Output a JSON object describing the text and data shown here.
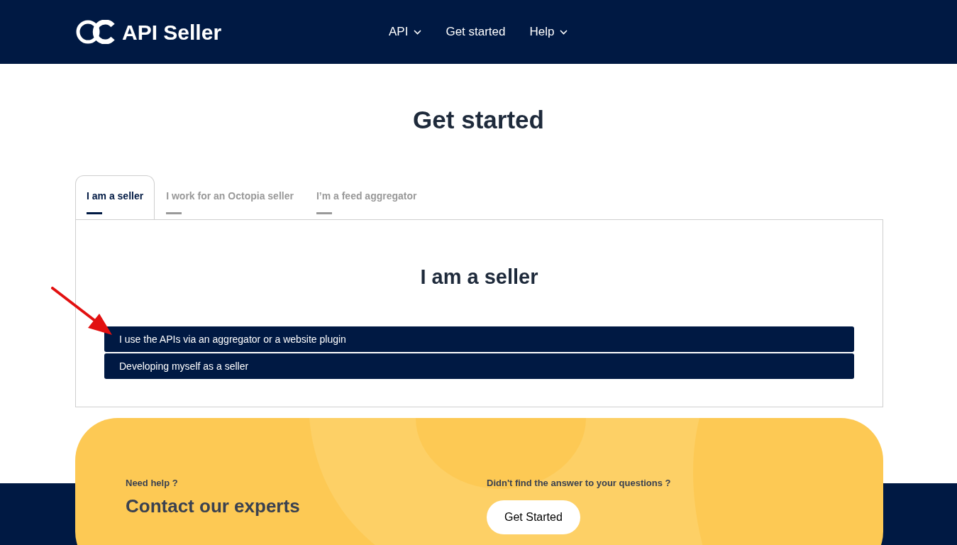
{
  "header": {
    "logo_text": "API Seller",
    "nav": [
      {
        "label": "API",
        "has_menu": true
      },
      {
        "label": "Get started",
        "has_menu": false
      },
      {
        "label": "Help",
        "has_menu": true
      }
    ]
  },
  "title": "Get started",
  "tabs": [
    {
      "label": "I am a seller",
      "selected": true
    },
    {
      "label": "I work for an Octopia seller",
      "selected": false
    },
    {
      "label": "I’m a feed aggregator",
      "selected": false
    }
  ],
  "panel": {
    "heading": "I am a seller",
    "options": [
      {
        "label": "I use the APIs via an aggregator or a website plugin",
        "annotated": true
      },
      {
        "label": "Developing myself as a seller",
        "annotated": false
      }
    ]
  },
  "help_banner": {
    "kicker": "Need help ?",
    "heading": "Contact our experts",
    "question": "Didn't find the answer to your questions ?",
    "button": "Get Started"
  }
}
